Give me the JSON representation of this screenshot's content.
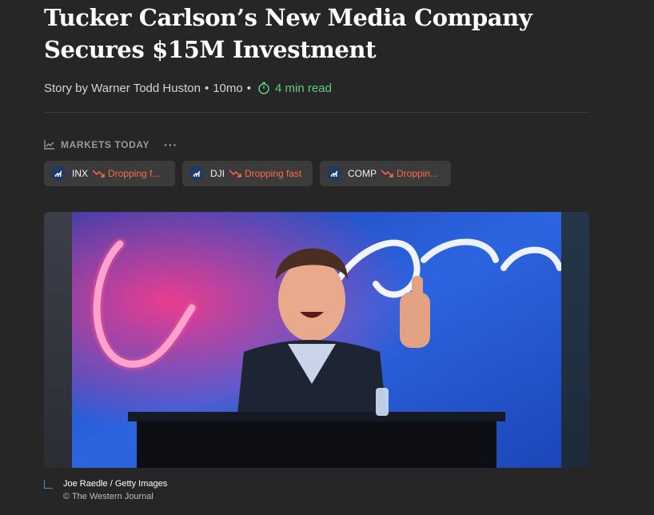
{
  "article": {
    "title": "Tucker Carlson’s New Media Company Secures $15M Investment",
    "byline_prefix": "Story by Warner Todd Huston",
    "age": "10mo",
    "read_time": "4 min read",
    "separator": "•"
  },
  "markets": {
    "heading": "MARKETS TODAY",
    "more_label": "···",
    "chips": [
      {
        "symbol": "INX",
        "status": "Dropping f..."
      },
      {
        "symbol": "DJI",
        "status": "Dropping fast"
      },
      {
        "symbol": "COMP",
        "status": "Droppin..."
      }
    ]
  },
  "figure": {
    "credit": "Joe Raedle / Getty Images",
    "source": "© The Western Journal"
  },
  "icons": {
    "timer": "stopwatch-icon",
    "markets": "line-chart-icon",
    "chip_badge": "market-trend-icon",
    "trend": "trending-down-icon"
  },
  "colors": {
    "background": "#262626",
    "accent_green": "#5fcf7d",
    "dropping_red": "#ff6a4d",
    "caption_accent": "#4a8bd6"
  }
}
